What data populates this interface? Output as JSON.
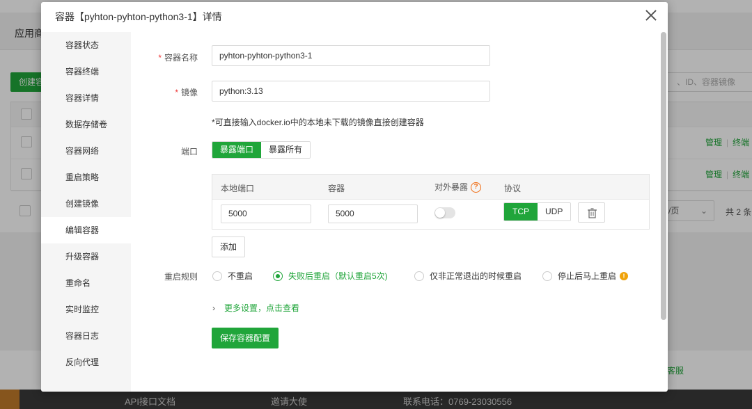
{
  "background": {
    "page_title": "应用商",
    "create_button": "创建容",
    "search_placeholder": "、ID、容器镜像",
    "row_ops": {
      "manage": "管理",
      "terminal": "终端"
    },
    "pager_size": "/页",
    "pager_total": "共 2 条",
    "customer_service": "客服",
    "footer_links": [
      "API接口文档",
      "邀请大使",
      "联系电话：0769-23030556"
    ]
  },
  "modal": {
    "title": "容器【pyhton-pyhton-python3-1】详情",
    "sidebar": [
      {
        "label": "容器状态",
        "active": false
      },
      {
        "label": "容器终端",
        "active": false
      },
      {
        "label": "容器详情",
        "active": false
      },
      {
        "label": "数据存储卷",
        "active": false
      },
      {
        "label": "容器网络",
        "active": false
      },
      {
        "label": "重启策略",
        "active": false
      },
      {
        "label": "创建镜像",
        "active": false
      },
      {
        "label": "编辑容器",
        "active": true
      },
      {
        "label": "升级容器",
        "active": false
      },
      {
        "label": "重命名",
        "active": false
      },
      {
        "label": "实时监控",
        "active": false
      },
      {
        "label": "容器日志",
        "active": false
      },
      {
        "label": "反向代理",
        "active": false
      }
    ],
    "form": {
      "name_label": "容器名称",
      "name_value": "pyhton-pyhton-python3-1",
      "image_label": "镜像",
      "image_value": "python:3.13",
      "image_tip": "*可直接输入docker.io中的本地未下载的镜像直接创建容器",
      "port_label": "端口",
      "port_modes": [
        "暴露端口",
        "暴露所有"
      ],
      "port_table": {
        "headers": [
          "本地端口",
          "容器",
          "对外暴露",
          "协议"
        ],
        "rows": [
          {
            "local": "5000",
            "container": "5000",
            "expose": false,
            "protocols": [
              "TCP",
              "UDP"
            ],
            "selected_protocol": "TCP"
          }
        ]
      },
      "add_button": "添加",
      "restart_label": "重启规则",
      "restart_options": [
        "不重启",
        "失败后重启（默认重启5次)",
        "仅非正常退出的时候重启",
        "停止后马上重启"
      ],
      "restart_selected": 1,
      "more_settings": "更多设置，点击查看",
      "save_button": "保存容器配置"
    }
  },
  "colors": {
    "accent": "#20a53a",
    "warning": "#f06a0f",
    "required": "#ee3333"
  },
  "icons": [
    "close-icon",
    "question-icon",
    "trash-icon",
    "info-icon",
    "chevron-right-icon"
  ]
}
